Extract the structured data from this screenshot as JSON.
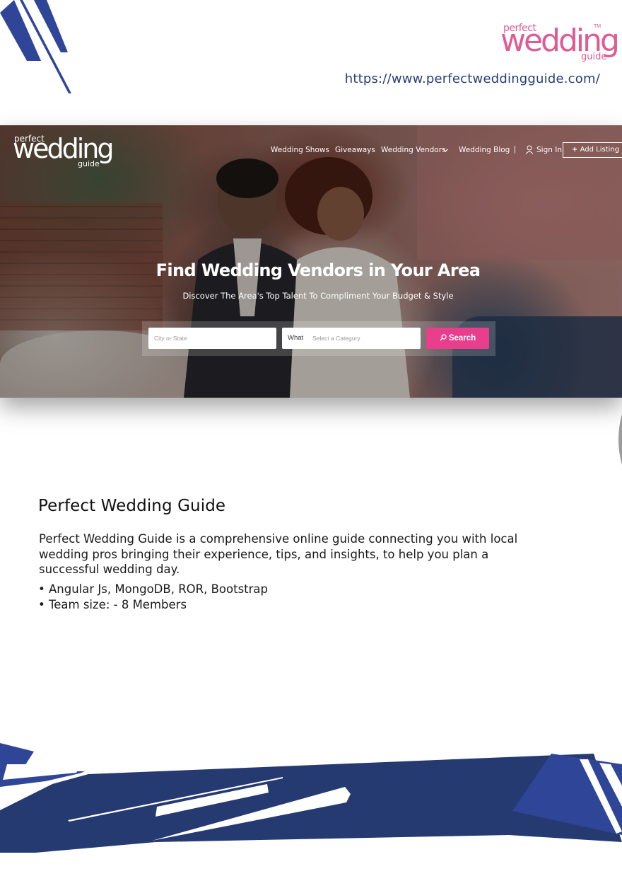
{
  "brand": {
    "logo_top": "perfect",
    "logo_main": "wedding",
    "logo_sub": "guide",
    "logo_tm": "TM",
    "url": "https://www.perfectweddingguide.com/",
    "pink": "#e05b93",
    "navy": "#2a3c7a"
  },
  "screenshot": {
    "nav": {
      "items": [
        "Wedding Shows",
        "Giveaways",
        "Wedding Vendors",
        "Wedding Blog"
      ],
      "separator": "|",
      "sign_in": "Sign In",
      "add_listing": "Add Listing"
    },
    "hero": {
      "title": "Find Wedding Vendors in Your Area",
      "subtitle": "Discover The Area's Top Talent To Compliment Your Budget & Style"
    },
    "search": {
      "city_placeholder": "City or State",
      "what_label": "What",
      "category_placeholder": "Select a Category",
      "button": "Search",
      "button_color": "#e83e8c"
    }
  },
  "content": {
    "title": "Perfect Wedding Guide",
    "description": "Perfect Wedding Guide is a comprehensive online guide connecting you with local wedding pros bringing their experience, tips, and insights, to help you plan a successful wedding day.",
    "bullets": [
      "• Angular Js, MongoDB, ROR, Bootstrap",
      "• Team size: - 8 Members"
    ]
  }
}
